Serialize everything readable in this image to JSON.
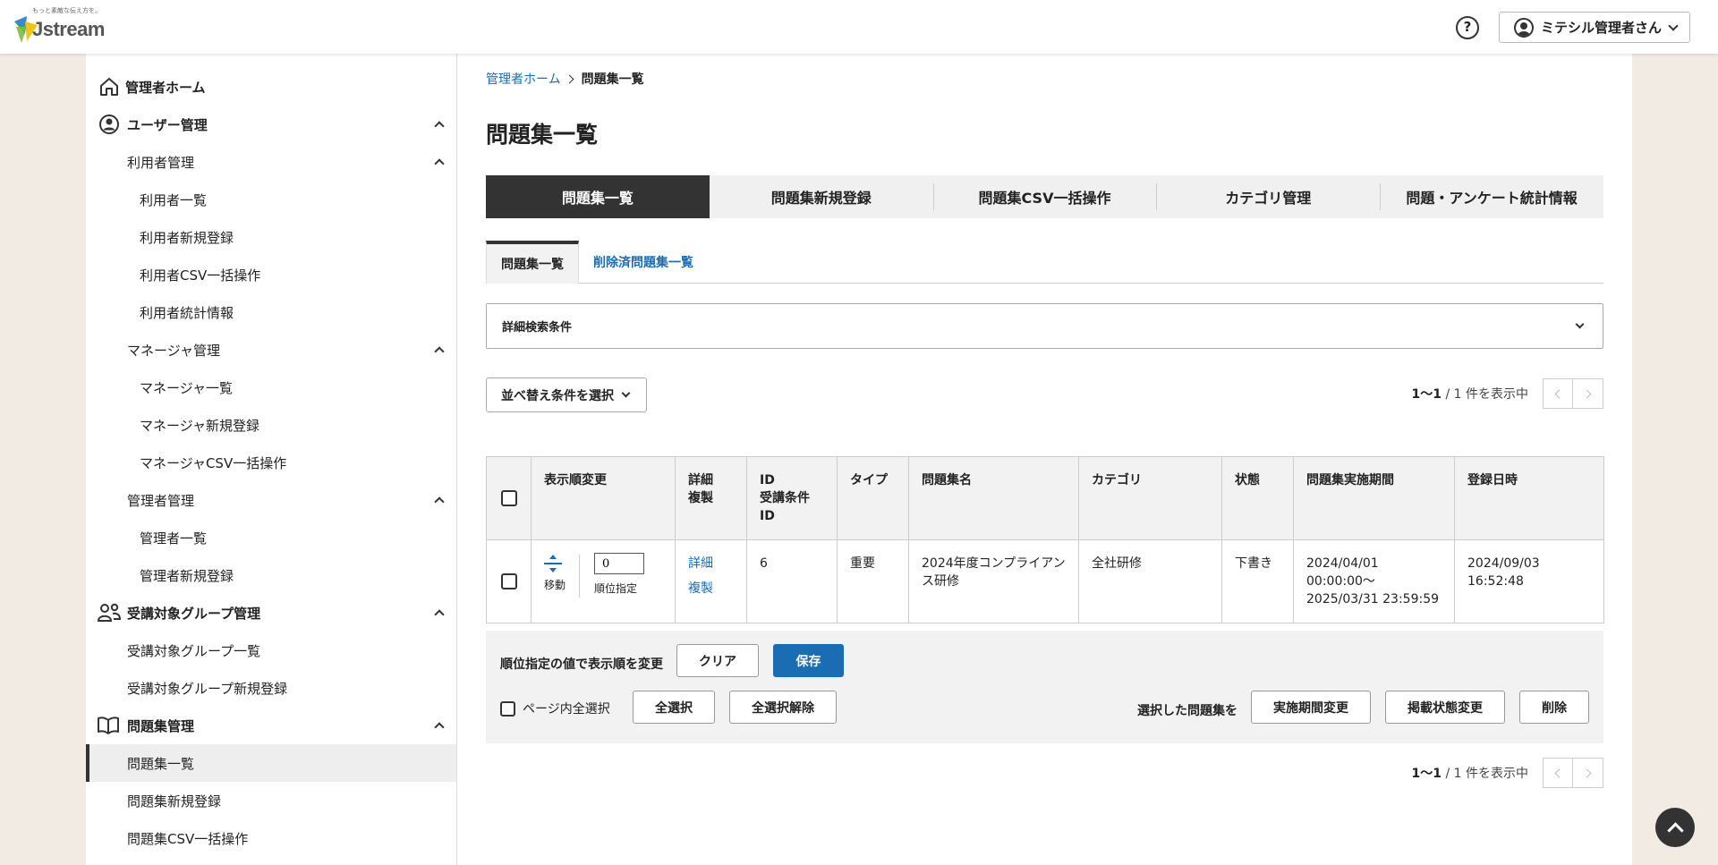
{
  "header": {
    "logo_tagline": "もっと素敵な伝え方を。",
    "logo_text": "Jstream",
    "help_icon": "question-circle-icon",
    "user_name": "ミテシル管理者さん"
  },
  "sidebar": {
    "items": [
      {
        "label": "管理者ホーム",
        "level": 0,
        "icon": "home-icon"
      },
      {
        "label": "ユーザー管理",
        "level": 0,
        "icon": "user-circle-icon",
        "expanded": true
      },
      {
        "label": "利用者管理",
        "level": 1,
        "expanded": true
      },
      {
        "label": "利用者一覧",
        "level": 2
      },
      {
        "label": "利用者新規登録",
        "level": 2
      },
      {
        "label": "利用者CSV一括操作",
        "level": 2
      },
      {
        "label": "利用者統計情報",
        "level": 2
      },
      {
        "label": "マネージャ管理",
        "level": 1,
        "expanded": true
      },
      {
        "label": "マネージャ一覧",
        "level": 2
      },
      {
        "label": "マネージャ新規登録",
        "level": 2
      },
      {
        "label": "マネージャCSV一括操作",
        "level": 2
      },
      {
        "label": "管理者管理",
        "level": 1,
        "expanded": true
      },
      {
        "label": "管理者一覧",
        "level": 2
      },
      {
        "label": "管理者新規登録",
        "level": 2
      },
      {
        "label": "受講対象グループ管理",
        "level": 0,
        "icon": "group-icon",
        "expanded": true
      },
      {
        "label": "受講対象グループ一覧",
        "level": 1
      },
      {
        "label": "受講対象グループ新規登録",
        "level": 1
      },
      {
        "label": "問題集管理",
        "level": 0,
        "icon": "book-icon",
        "expanded": true
      },
      {
        "label": "問題集一覧",
        "level": 1,
        "active": true
      },
      {
        "label": "問題集新規登録",
        "level": 1
      },
      {
        "label": "問題集CSV一括操作",
        "level": 1
      }
    ]
  },
  "breadcrumb": {
    "home": "管理者ホーム",
    "current": "問題集一覧"
  },
  "page_title": "問題集一覧",
  "main_tabs": [
    "問題集一覧",
    "問題集新規登録",
    "問題集CSV一括操作",
    "カテゴリ管理",
    "問題・アンケート統計情報"
  ],
  "sub_tabs": [
    "問題集一覧",
    "削除済問題集一覧"
  ],
  "search": {
    "label": "詳細検索条件"
  },
  "sort": {
    "label": "並べ替え条件を選択"
  },
  "pager": {
    "range": "1〜1",
    "suffix": " / 1 件を表示中"
  },
  "table": {
    "headers": {
      "order": "表示順変更",
      "detail": "詳細",
      "copy": "複製",
      "id": "ID",
      "cond_id": "受講条件ID",
      "type": "タイプ",
      "name": "問題集名",
      "category": "カテゴリ",
      "status": "状態",
      "period": "問題集実施期間",
      "registered": "登録日時"
    },
    "rows": [
      {
        "move_label": "移動",
        "order_value": "0",
        "order_label": "順位指定",
        "detail_link": "詳細",
        "copy_link": "複製",
        "id": "6",
        "type": "重要",
        "name": "2024年度コンプライアンス研修",
        "category": "全社研修",
        "status": "下書き",
        "period_start": "2024/04/01 00:00:00〜",
        "period_end": "2025/03/31 23:59:59",
        "registered": "2024/09/03 16:52:48"
      }
    ]
  },
  "actions": {
    "order_change_label": "順位指定の値で表示順を変更",
    "clear": "クリア",
    "save": "保存",
    "page_select_all": "ページ内全選択",
    "select_all": "全選択",
    "deselect_all": "全選択解除",
    "selected_label": "選択した問題集を",
    "change_period": "実施期間変更",
    "change_status": "掲載状態変更",
    "delete": "削除"
  },
  "colors": {
    "accent": "#1a6cb3",
    "dark": "#333333",
    "background": "#f1ebe3"
  }
}
